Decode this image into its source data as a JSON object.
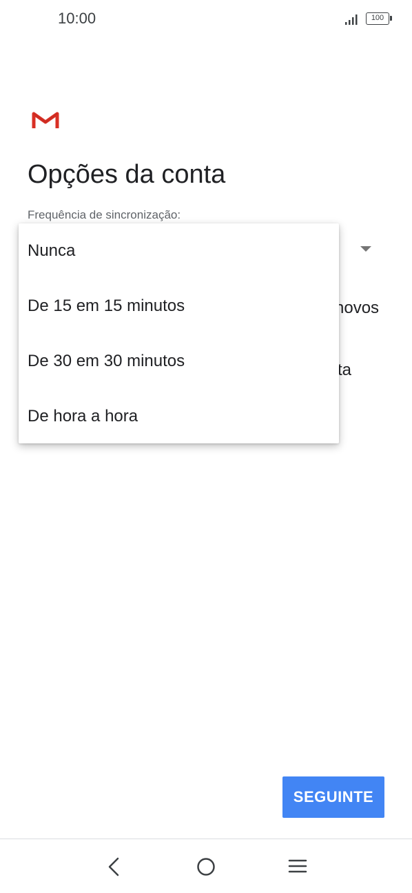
{
  "status_bar": {
    "time": "10:00",
    "battery": "100",
    "signal_icon": "signal-icon"
  },
  "app": {
    "logo_icon": "gmail-logo-icon"
  },
  "page": {
    "title": "Opções da conta",
    "sync_label": "Frequência de sincronização:",
    "background_fragment_1": "novos",
    "background_fragment_2": "ta"
  },
  "dropdown": {
    "options": [
      {
        "label": "Nunca"
      },
      {
        "label": "De 15 em 15 minutos"
      },
      {
        "label": "De 30 em 30 minutos"
      },
      {
        "label": "De hora a hora"
      }
    ]
  },
  "footer": {
    "next_label": "SEGUINTE",
    "accent_color": "#4285f4"
  },
  "nav_bar": {
    "back_icon": "back-icon",
    "home_icon": "home-icon",
    "menu_icon": "menu-icon"
  }
}
